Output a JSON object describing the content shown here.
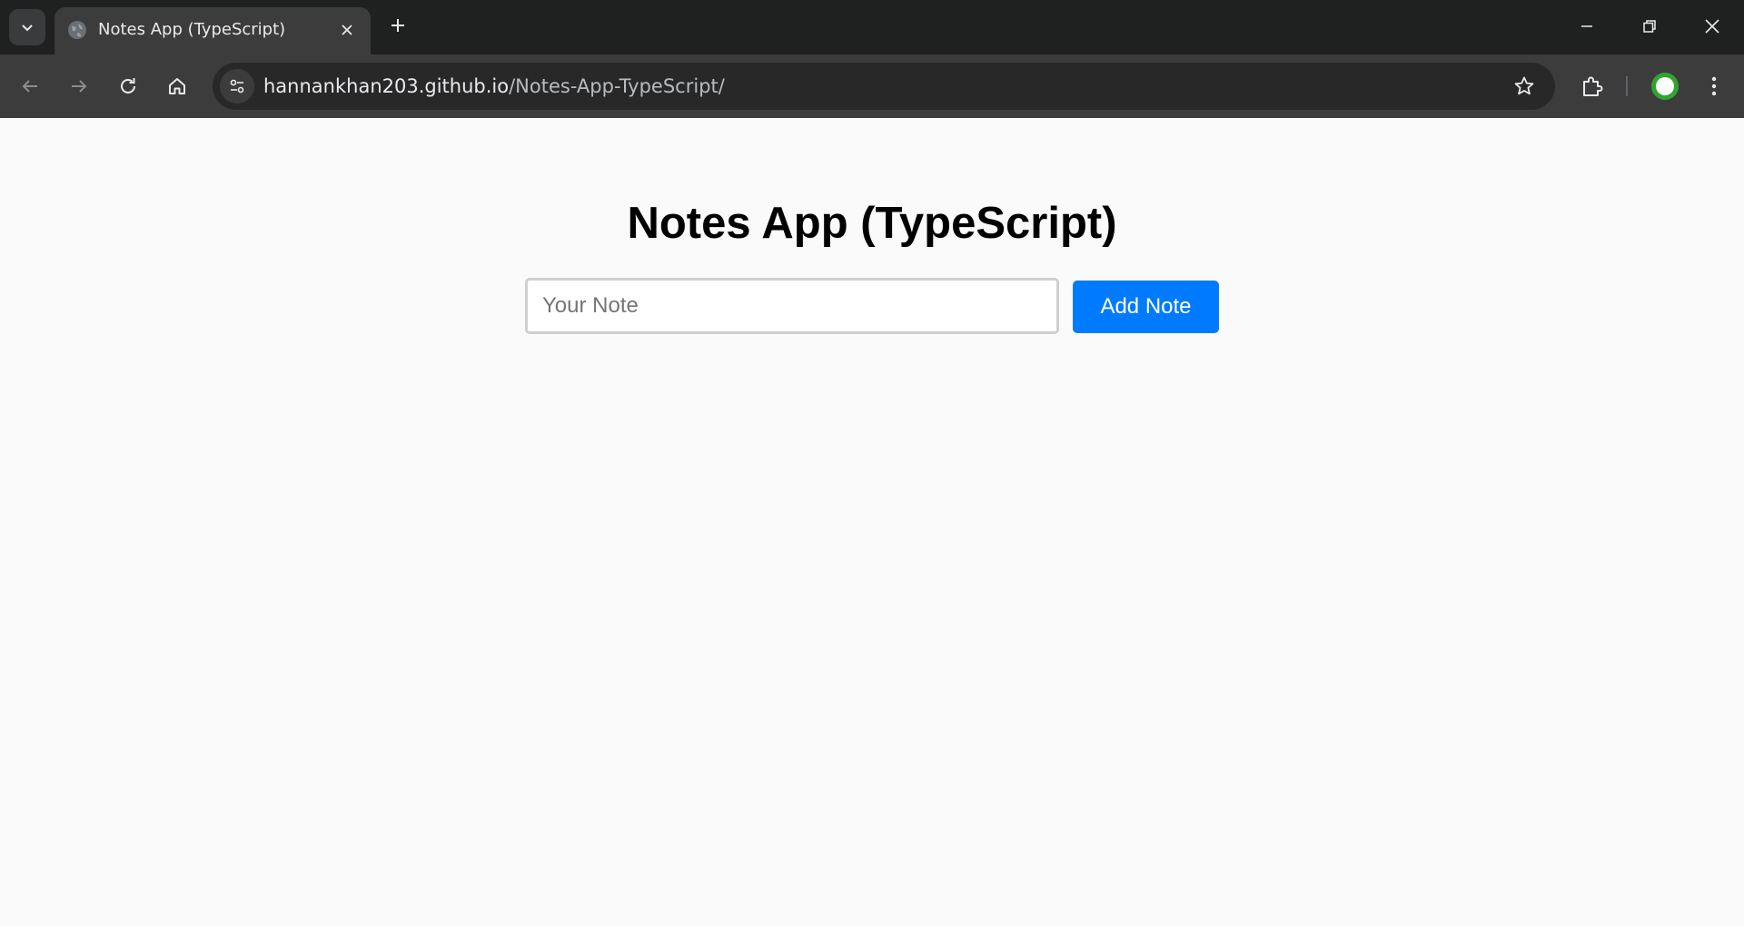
{
  "browser": {
    "tab": {
      "title": "Notes App (TypeScript)",
      "favicon": "globe-icon"
    },
    "address_bar": {
      "url_host": "hannankhan203.github.io",
      "url_path": "/Notes-App-TypeScript/"
    },
    "icons": {
      "tab_search": "chevron-down-icon",
      "tab_close": "close-icon",
      "new_tab": "plus-icon",
      "minimize": "minimize-icon",
      "restore": "restore-icon",
      "close_window": "close-icon",
      "back": "back-arrow-icon",
      "forward": "forward-arrow-icon",
      "reload": "reload-icon",
      "home": "home-icon",
      "site_info": "tune-icon",
      "bookmark": "star-icon",
      "extensions": "puzzle-icon",
      "profile": "avatar",
      "menu": "kebab-menu-icon"
    },
    "colors": {
      "tabbar_bg": "#1f2020",
      "toolbar_bg": "#3c3c3c",
      "omnibox_bg": "#282828"
    }
  },
  "app": {
    "title": "Notes App (TypeScript)",
    "note_input": {
      "placeholder": "Your Note",
      "value": ""
    },
    "add_button_label": "Add Note",
    "colors": {
      "page_bg": "#fafafa",
      "button_bg": "#007bff",
      "button_text": "#ffffff",
      "input_border": "#cfcfcf"
    }
  }
}
